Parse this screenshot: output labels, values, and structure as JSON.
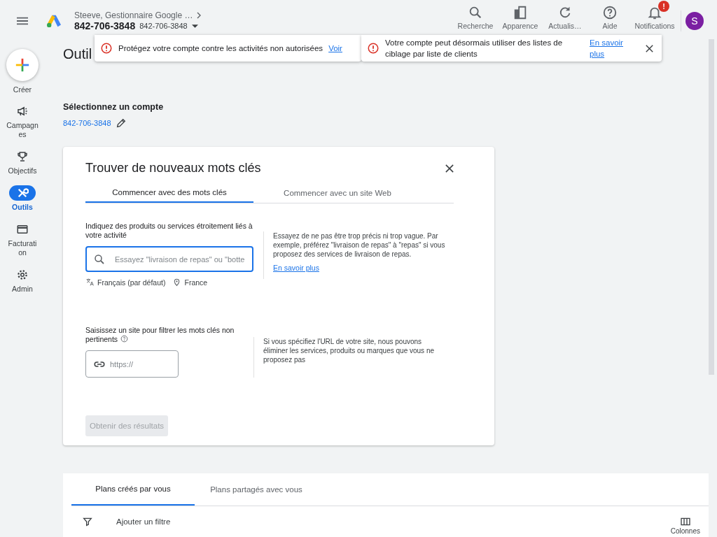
{
  "header": {
    "account_path": "Steeve, Gestionnaire Google …",
    "account_id": "842-706-3848",
    "account_sub_id": "842-706-3848",
    "actions": [
      {
        "label": "Recherche",
        "kind": "search"
      },
      {
        "label": "Apparence",
        "kind": "appearance"
      },
      {
        "label": "Actualis…",
        "kind": "refresh"
      },
      {
        "label": "Aide",
        "kind": "help"
      },
      {
        "label": "Notifications",
        "kind": "bell",
        "badge": "!"
      }
    ],
    "avatar": "S"
  },
  "alerts": [
    {
      "text": "Protégez votre compte contre les activités non autorisées",
      "link": "Voir",
      "closable": false
    },
    {
      "text": "Votre compte peut désormais utiliser des listes de ciblage par liste de clients",
      "link": "En savoir plus",
      "closable": true
    }
  ],
  "sidebar": {
    "create": "Créer",
    "items": [
      {
        "label": "Campagnes",
        "kind": "campaigns",
        "selected": false
      },
      {
        "label": "Objectifs",
        "kind": "goals",
        "selected": false
      },
      {
        "label": "Outils",
        "kind": "tools",
        "selected": true
      },
      {
        "label": "Facturation",
        "kind": "billing",
        "selected": false
      },
      {
        "label": "Admin",
        "kind": "admin",
        "selected": false
      }
    ]
  },
  "page_title": "Outil",
  "account_select": {
    "title": "Sélectionnez un compte",
    "account": "842-706-3848"
  },
  "dialog": {
    "title": "Trouver de nouveaux mots clés",
    "tabs": [
      {
        "label": "Commencer avec des mots clés",
        "selected": true
      },
      {
        "label": "Commencer avec un site Web",
        "selected": false
      }
    ],
    "keywords": {
      "label": "Indiquez des produits ou services étroitement liés à votre activité",
      "placeholder": "Essayez \"livraison de repas\" ou \"botte",
      "language": "Français (par défaut)",
      "location": "France",
      "hint": "Essayez de ne pas être trop précis ni trop vague. Par exemple, préférez \"livraison de repas\" à \"repas\" si vous proposez des services de livraison de repas.",
      "hint_link": "En savoir plus"
    },
    "site": {
      "label": "Saisissez un site pour filtrer les mots clés non pertinents",
      "placeholder": "https://",
      "hint": "Si vous spécifiez l'URL de votre site, nous pouvons éliminer les services, produits ou marques que vous ne proposez pas"
    },
    "submit": {
      "label": "Obtenir des résultats",
      "disabled": true
    }
  },
  "plans": {
    "tabs": [
      {
        "label": "Plans créés par vous",
        "selected": true
      },
      {
        "label": "Plans partagés avec vous",
        "selected": false
      }
    ],
    "filter": "Ajouter un filtre",
    "columns": "Colonnes"
  }
}
